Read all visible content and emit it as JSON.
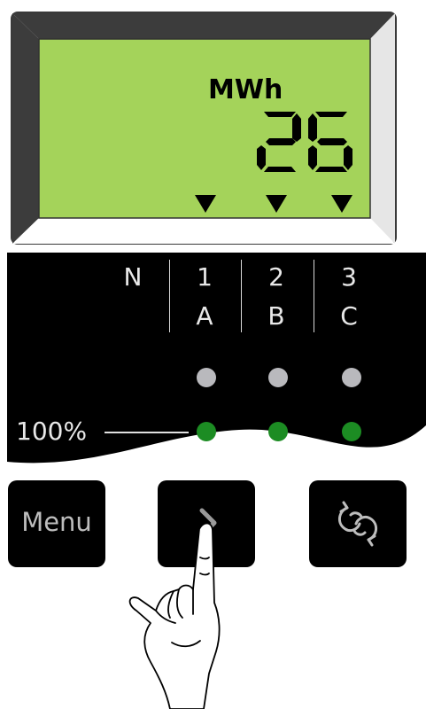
{
  "display": {
    "unit": "MWh",
    "value": "26",
    "markers": [
      "phase-1",
      "phase-2",
      "phase-3"
    ]
  },
  "phases": {
    "neutral": "N",
    "numbers": [
      "1",
      "2",
      "3"
    ],
    "letters": [
      "A",
      "B",
      "C"
    ]
  },
  "leds": {
    "top_row_color": "#b9b9bd",
    "bottom_row_color": "#1c8c23"
  },
  "load_level": "100%",
  "buttons": {
    "menu_label": "Menu",
    "next_icon": "chevron-right-icon",
    "cycle_icon": "cycle-arrows-icon"
  },
  "colors": {
    "lcd_background": "#a4d35a",
    "panel_background": "#000000"
  }
}
